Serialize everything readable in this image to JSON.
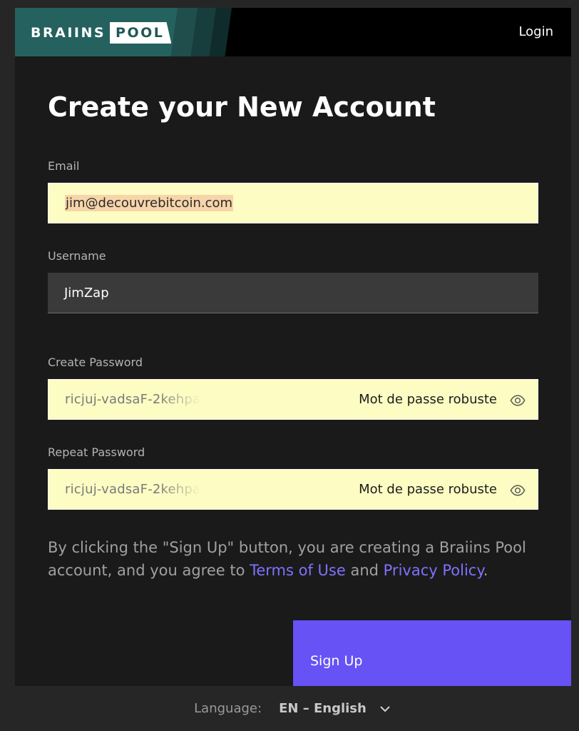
{
  "header": {
    "logo_word": "BRAIINS",
    "logo_badge": "POOL",
    "login_label": "Login"
  },
  "page_title": "Create your New Account",
  "form": {
    "email": {
      "label": "Email",
      "value": "jim@decouvrebitcoin.com"
    },
    "username": {
      "label": "Username",
      "value": "JimZap"
    },
    "create_password": {
      "label": "Create Password",
      "value": "ricjuj-vadsaF-2kehpa",
      "hint": "Mot de passe robuste"
    },
    "repeat_password": {
      "label": "Repeat Password",
      "value": "ricjuj-vadsaF-2kehpa",
      "hint": "Mot de passe robuste"
    }
  },
  "terms": {
    "prefix": "By clicking the \"Sign Up\" button, you are creating a Braiins Pool account, and you agree to ",
    "terms_link": "Terms of Use",
    "middle": " and ",
    "privacy_link": "Privacy Policy",
    "suffix": "."
  },
  "signup_label": "Sign Up",
  "language": {
    "label": "Language:",
    "value": "EN – English"
  },
  "icons": {
    "password_toggle": "eye-icon",
    "language_dropdown": "chevron-down-icon"
  },
  "colors": {
    "accent": "#6652f5",
    "link": "#7e72ff",
    "brand_teal": "#24615f",
    "autofill": "#fcfcc3"
  }
}
